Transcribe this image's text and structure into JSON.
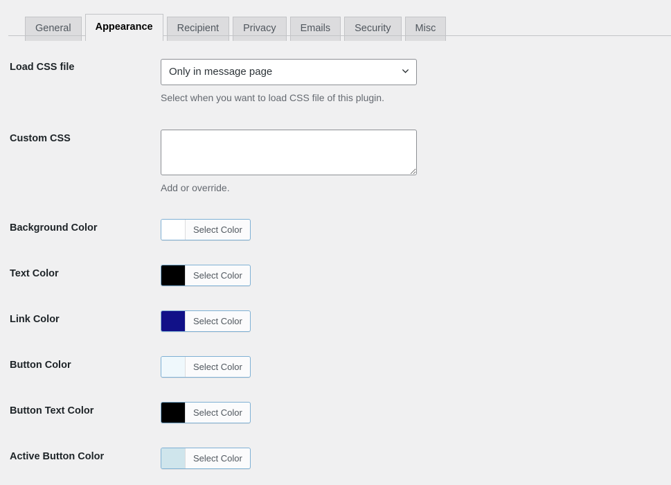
{
  "tabs": [
    {
      "label": "General",
      "active": false
    },
    {
      "label": "Appearance",
      "active": true
    },
    {
      "label": "Recipient",
      "active": false
    },
    {
      "label": "Privacy",
      "active": false
    },
    {
      "label": "Emails",
      "active": false
    },
    {
      "label": "Security",
      "active": false
    },
    {
      "label": "Misc",
      "active": false
    }
  ],
  "fields": {
    "load_css": {
      "label": "Load CSS file",
      "selected": "Only in message page",
      "options": [
        "Only in message page"
      ],
      "help": "Select when you want to load CSS file of this plugin."
    },
    "custom_css": {
      "label": "Custom CSS",
      "value": "",
      "placeholder": "",
      "help": "Add or override."
    },
    "background_color": {
      "label": "Background Color",
      "button_label": "Select Color",
      "color": "#ffffff"
    },
    "text_color": {
      "label": "Text Color",
      "button_label": "Select Color",
      "color": "#000000"
    },
    "link_color": {
      "label": "Link Color",
      "button_label": "Select Color",
      "color": "#111188"
    },
    "button_color": {
      "label": "Button Color",
      "button_label": "Select Color",
      "color": "#eff8fc"
    },
    "button_text_color": {
      "label": "Button Text Color",
      "button_label": "Select Color",
      "color": "#000000"
    },
    "active_button_color": {
      "label": "Active Button Color",
      "button_label": "Select Color",
      "color": "#cfe5ec"
    }
  },
  "icons": {
    "chevron_down": "chevron-down-icon"
  }
}
